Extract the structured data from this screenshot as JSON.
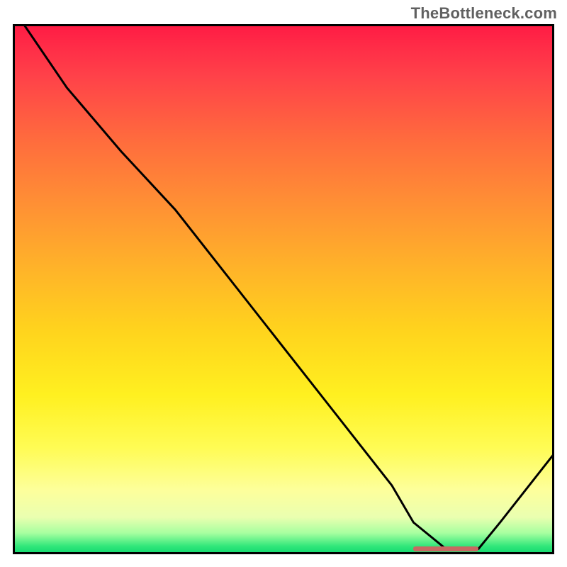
{
  "watermark": "TheBottleneck.com",
  "colors": {
    "gradient_top": "#ff1a44",
    "gradient_mid": "#ffd41d",
    "gradient_bottom": "#0fd66e",
    "curve": "#000000",
    "border": "#000000",
    "valley_marker": "#c86962"
  },
  "chart_data": {
    "type": "line",
    "title": "",
    "xlabel": "",
    "ylabel": "",
    "xlim": [
      0,
      100
    ],
    "ylim": [
      0,
      100
    ],
    "grid": false,
    "legend": false,
    "series": [
      {
        "name": "bottleneck-curve",
        "x": [
          2,
          10,
          20,
          30,
          40,
          50,
          60,
          70,
          74,
          80,
          86,
          90,
          100
        ],
        "y": [
          100,
          88,
          76,
          65,
          52,
          39,
          26,
          13,
          6,
          1,
          1,
          6,
          19
        ]
      }
    ],
    "annotations": [
      {
        "name": "valley-marker",
        "x_start": 74,
        "x_end": 86,
        "y": 1
      }
    ]
  }
}
